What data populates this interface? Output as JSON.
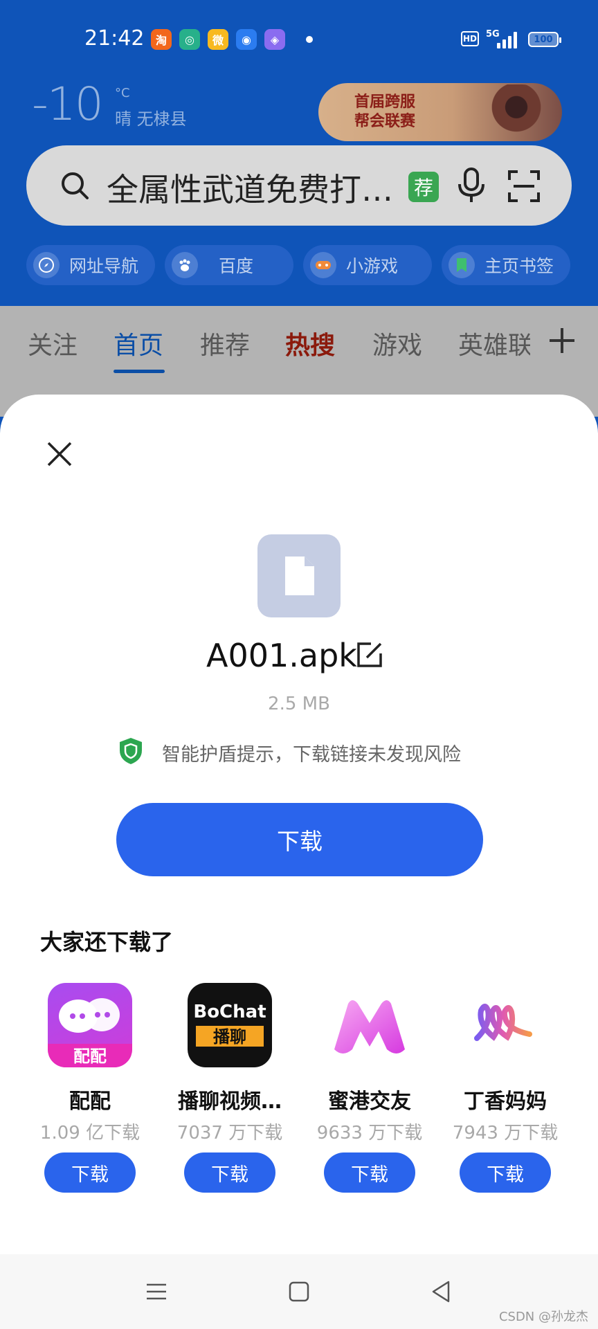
{
  "status_bar": {
    "time": "21:42",
    "apps": [
      {
        "icon": "taobao-icon",
        "glyph": "淘",
        "color": "#f2671c"
      },
      {
        "icon": "green-app-icon",
        "glyph": "◎",
        "color": "#27b08a"
      },
      {
        "icon": "weibo-icon",
        "glyph": "微",
        "color": "#f8b920"
      },
      {
        "icon": "browser-icon",
        "glyph": "◉",
        "color": "#2b7cf0"
      },
      {
        "icon": "shop-bag-icon",
        "glyph": "◈",
        "color": "#8a6cf0"
      }
    ],
    "hd": "HD",
    "network": "5G",
    "battery": "100"
  },
  "weather": {
    "temperature": "-10",
    "unit": "°C",
    "description": "晴 无棣县"
  },
  "banner": {
    "line1": "首届跨服",
    "line2": "帮会联赛"
  },
  "search": {
    "query": "全属性武道免费打金传奇",
    "badge": "荐"
  },
  "quick_links": [
    {
      "label": "网址导航",
      "icon": "compass-icon"
    },
    {
      "label": "百度",
      "icon": "baidu-paw-icon"
    },
    {
      "label": "小游戏",
      "icon": "gamepad-icon"
    },
    {
      "label": "主页书签",
      "icon": "bookmark-icon"
    }
  ],
  "tabs": [
    {
      "label": "关注"
    },
    {
      "label": "首页"
    },
    {
      "label": "推荐"
    },
    {
      "label": "热搜"
    },
    {
      "label": "游戏"
    },
    {
      "label": "英雄联"
    }
  ],
  "download_sheet": {
    "file_name": "A001.apk",
    "file_size": "2.5 MB",
    "safety_notice": "智能护盾提示，下载链接未发现风险",
    "download_label": "下载",
    "recommend_title": "大家还下载了"
  },
  "recommended_apps": [
    {
      "name": "配配",
      "downloads": "1.09 亿下载",
      "button": "下载",
      "icon_text": "配配"
    },
    {
      "name": "播聊视频…",
      "downloads": "7037 万下载",
      "button": "下载",
      "icon_text_top": "BoChat",
      "icon_text_bottom": "播聊"
    },
    {
      "name": "蜜港交友",
      "downloads": "9633 万下载",
      "button": "下载"
    },
    {
      "name": "丁香妈妈",
      "downloads": "7943 万下载",
      "button": "下载"
    }
  ],
  "watermark": "CSDN @孙龙杰"
}
